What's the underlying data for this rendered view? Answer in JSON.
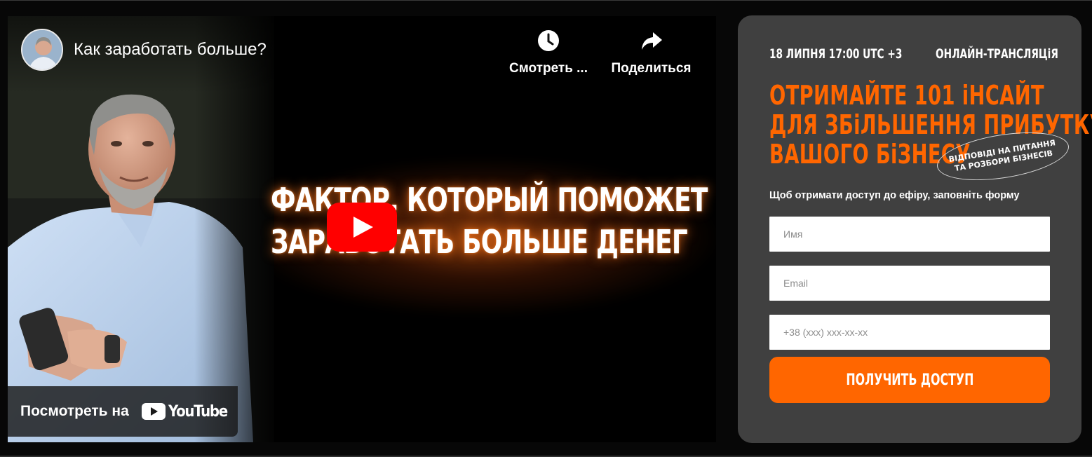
{
  "video": {
    "title": "Как заработать больше?",
    "headline_line1": "ФАКТОР, КОТОРЫЙ ПОМОЖЕТ",
    "headline_line2": "ЗАРАБОТАТЬ БОЛЬШЕ ДЕНЕГ",
    "watch_later_label": "Смотреть ...",
    "share_label": "Поделиться",
    "watch_on_label": "Посмотреть на",
    "youtube_wordmark": "YouTube",
    "icons": {
      "watch_later": "clock-icon",
      "share": "share-arrow-icon",
      "play": "play-icon",
      "youtube": "youtube-logo-icon"
    },
    "colors": {
      "play_button": "#ff0000",
      "glow": "#ff6e14"
    }
  },
  "card": {
    "date": "18 ЛИПНЯ 17:00 UTC +3",
    "format": "ОНЛАЙН-ТРАНСЛЯЦіЯ",
    "heading_line1": "ОТРИМАЙТЕ 101 іНСАЙТ",
    "heading_line2": "ДЛЯ ЗБіЛЬШЕННЯ ПРИБУТКУ",
    "heading_line3": "ВАШОГО БіЗНЕСУ",
    "stamp_line1": "ВІДПОВІДІ НА ПИТАННЯ",
    "stamp_line2": "ТА РОЗБОРИ БІЗНЕСІВ",
    "hint": "Щоб отримати доступ до ефіру, заповніть форму",
    "name_placeholder": "Имя",
    "email_placeholder": "Email",
    "phone_placeholder": "+38 (xxx) xxx-xx-xx",
    "submit_label": "ПОЛУЧИТЬ ДОСТУП",
    "colors": {
      "accent": "#ff6600",
      "card_background": "#404040"
    }
  }
}
